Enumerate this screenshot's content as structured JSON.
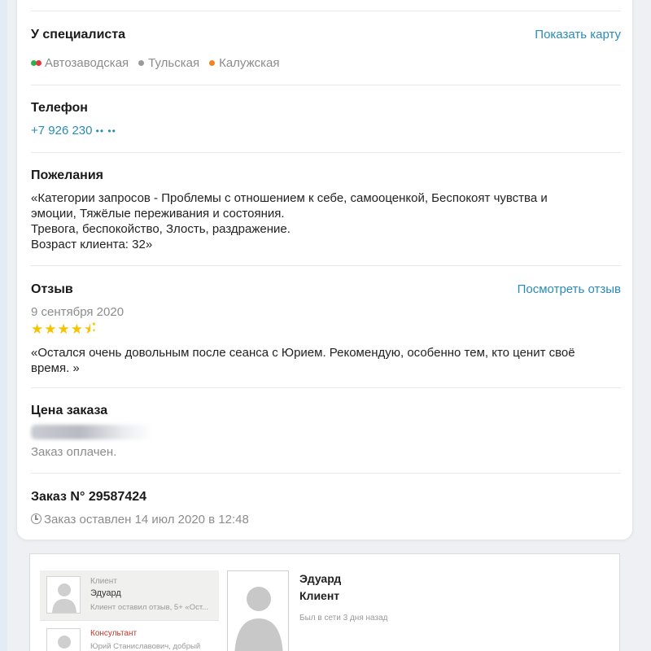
{
  "specialist": {
    "heading": "У специалиста",
    "map_link": "Показать карту",
    "metro": [
      {
        "name": "Автозаводская",
        "colors": [
          "#2db24a",
          "#e0393e"
        ]
      },
      {
        "name": "Тульская",
        "colors": [
          "#9a9a9a"
        ]
      },
      {
        "name": "Калужская",
        "colors": [
          "#f58220"
        ]
      }
    ]
  },
  "phone": {
    "heading": "Телефон",
    "value": "+7 926 230",
    "masked": "•• ••"
  },
  "wishes": {
    "heading": "Пожелания",
    "lines": [
      "«Категории запросов - Проблемы с отношением к себе, самооценкой, Беспокоят чувства и",
      "эмоции, Тяжёлые переживания и состояния.",
      "Тревога, беспокойство, Злость, раздражение.",
      "Возраст клиента: 32»"
    ]
  },
  "review": {
    "heading": "Отзыв",
    "link": "Посмотреть отзыв",
    "date": "9 сентября 2020",
    "rating": 4.5,
    "stars": [
      "★",
      "★",
      "★",
      "★",
      "★"
    ],
    "lines": [
      "«Остался очень довольным после сеанса с Юрием. Рекомендую, особенно тем, кто ценит своё",
      "время. »"
    ]
  },
  "price": {
    "heading": "Цена заказа",
    "status": "Заказ оплачен."
  },
  "order": {
    "heading": "Заказ N° 29587424",
    "placed": "Заказ оставлен 14 июл 2020 в 12:48"
  },
  "chat": {
    "dialogs": [
      {
        "role": "Клиент",
        "name": "Эдуард",
        "preview": "Клиент оставил отзыв, 5+ «Ост..."
      },
      {
        "role": "Консультант",
        "name": "Юрий Станиславович, добрый",
        "preview": ""
      }
    ],
    "profile": {
      "name": "Эдуард",
      "role": "Клиент",
      "online": "Был в сети 3 дня назад"
    }
  }
}
